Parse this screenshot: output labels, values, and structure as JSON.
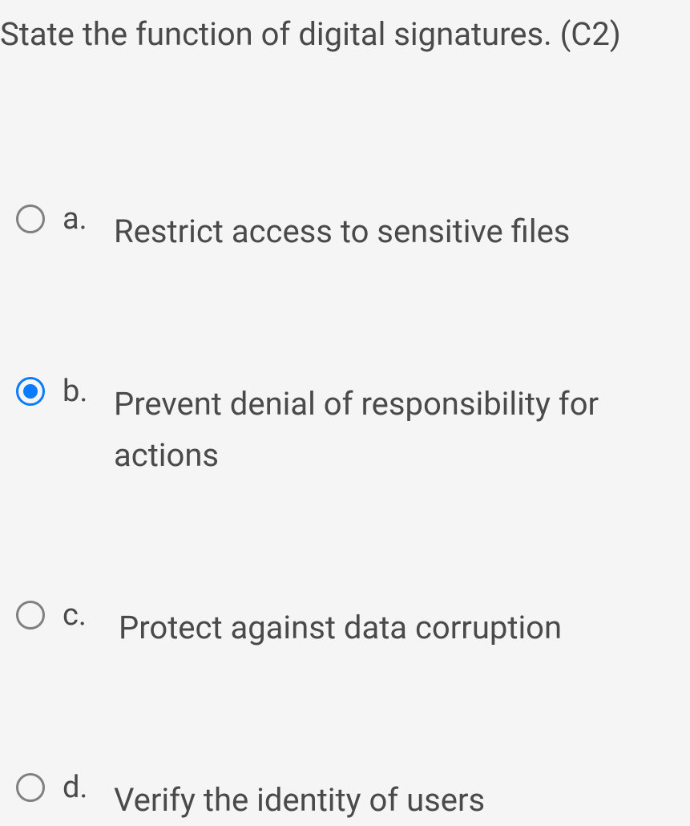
{
  "question": {
    "text": "State the function of digital signatures. (C2)"
  },
  "options": [
    {
      "letter": "a.",
      "text": "Restrict access to sensitive files",
      "selected": false
    },
    {
      "letter": "b.",
      "text": "Prevent denial of responsibility for actions",
      "selected": true
    },
    {
      "letter": "c.",
      "text": "Protect against data corruption",
      "selected": false
    },
    {
      "letter": "d.",
      "text": "Verify the identity of users",
      "selected": false
    }
  ]
}
